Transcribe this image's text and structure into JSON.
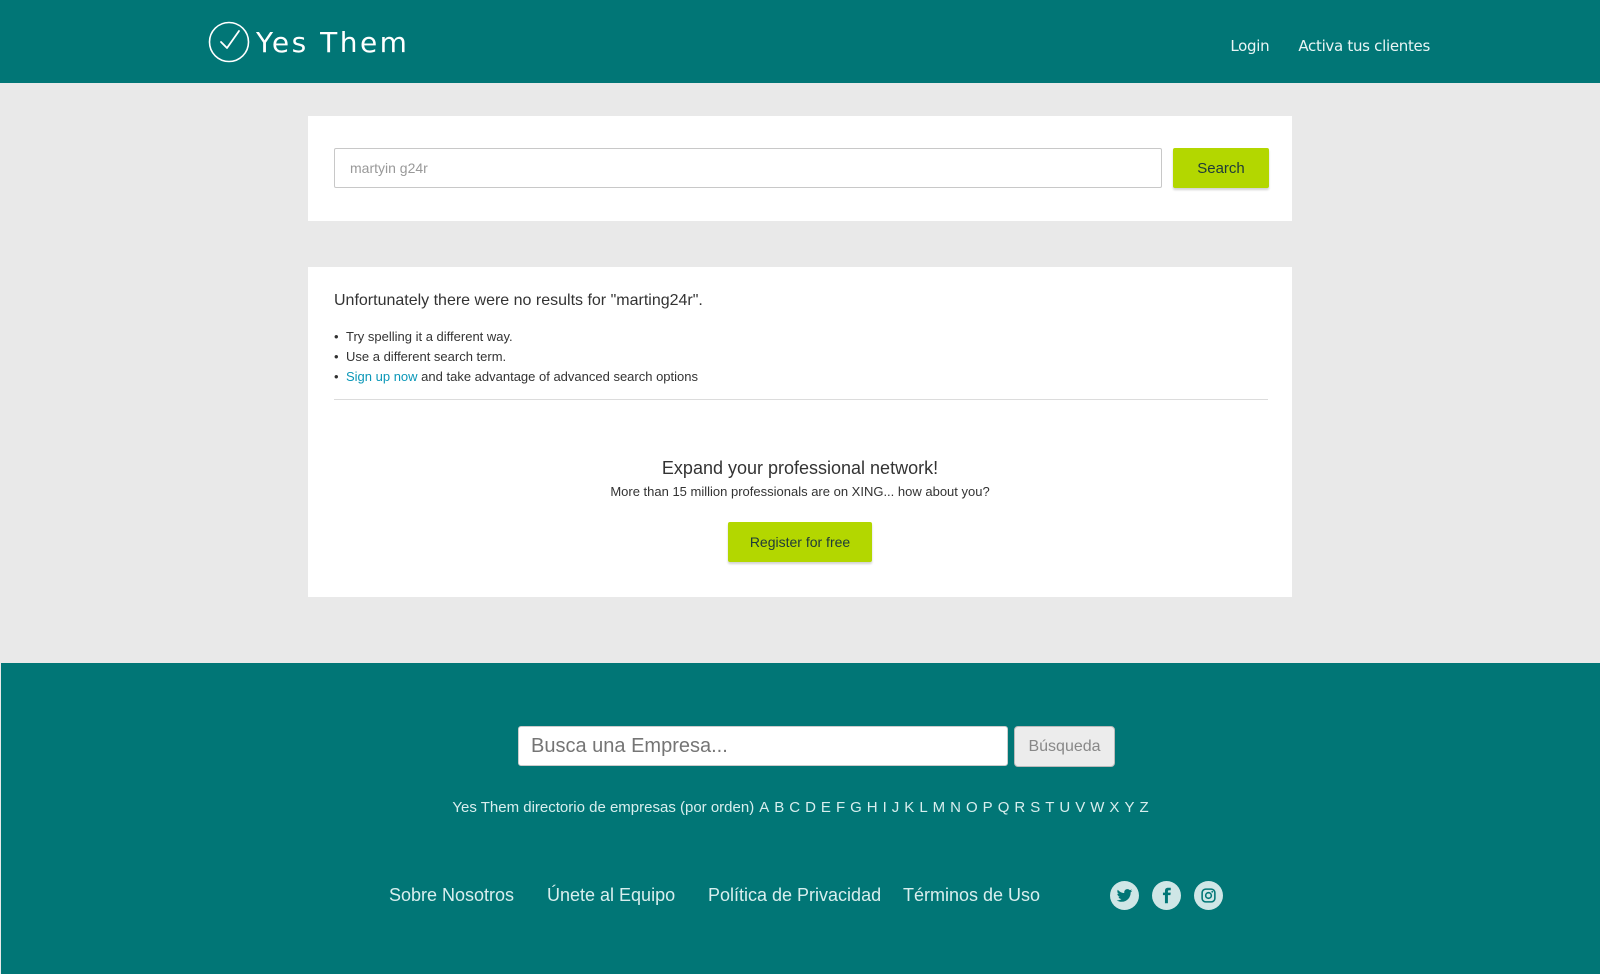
{
  "header": {
    "logo_text": "Yes Them",
    "nav": {
      "login": "Login",
      "activate_clients": "Activa tus clientes"
    }
  },
  "search": {
    "value": "martyin g24r",
    "button_label": "Search"
  },
  "results": {
    "message": "Unfortunately there were no results for \"marting24r\".",
    "tips": {
      "tip1": "Try spelling it a different way.",
      "tip2": "Use a different search term.",
      "tip3_link": "Sign up now",
      "tip3_text": " and take advantage of advanced search options"
    },
    "promo": {
      "title": "Expand your professional network!",
      "subtitle": "More than 15 million professionals are on XING... how about you?",
      "register_label": "Register for free"
    }
  },
  "footer": {
    "search_placeholder": "Busca una Empresa...",
    "search_button": "Búsqueda",
    "directory_label": "Yes Them directorio de empresas (por orden)",
    "letters": [
      "A",
      "B",
      "C",
      "D",
      "E",
      "F",
      "G",
      "H",
      "I",
      "J",
      "K",
      "L",
      "M",
      "N",
      "O",
      "P",
      "Q",
      "R",
      "S",
      "T",
      "U",
      "V",
      "W",
      "X",
      "Y",
      "Z"
    ],
    "links": {
      "about": "Sobre Nosotros",
      "team": "Únete al Equipo",
      "privacy": "Política de Privacidad",
      "terms": "Términos de Uso"
    },
    "social_icons": [
      "twitter-icon",
      "facebook-icon",
      "instagram-icon"
    ]
  },
  "colors": {
    "brand_teal": "#017676",
    "accent_green": "#b3d700",
    "link_blue": "#0a97b8",
    "page_bg": "#e9e9e9"
  }
}
